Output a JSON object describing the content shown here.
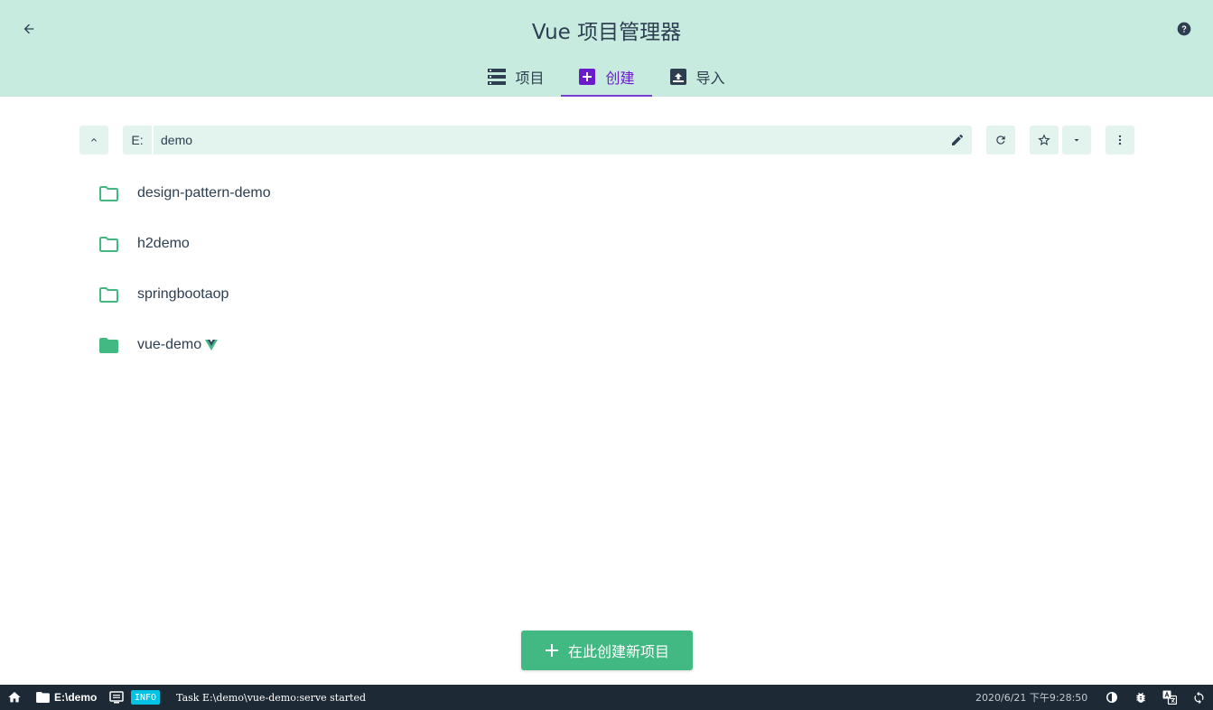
{
  "header": {
    "title": "Vue 项目管理器"
  },
  "tabs": [
    {
      "label": "项目",
      "icon": "list-icon",
      "active": false
    },
    {
      "label": "创建",
      "icon": "add-box-icon",
      "active": true
    },
    {
      "label": "导入",
      "icon": "unarchive-icon",
      "active": false
    }
  ],
  "toolbar": {
    "drive": "E:",
    "path": "demo"
  },
  "folders": [
    {
      "name": "design-pattern-demo",
      "filled": false,
      "vue": false
    },
    {
      "name": "h2demo",
      "filled": false,
      "vue": false
    },
    {
      "name": "springbootaop",
      "filled": false,
      "vue": false
    },
    {
      "name": "vue-demo",
      "filled": true,
      "vue": true
    }
  ],
  "create_button": {
    "label": "在此创建新项目"
  },
  "statusbar": {
    "folder": "E:\\demo",
    "badge": "INFO",
    "message": "Task E:\\demo\\vue-demo:serve started",
    "time": "2020/6/21  下午9:28:50"
  },
  "colors": {
    "header_bg": "#c8ebe0",
    "accent_green": "#42b983",
    "active_tab": "#6a1bcc",
    "statusbar_bg": "#1d2935",
    "badge": "#03c2e6"
  }
}
